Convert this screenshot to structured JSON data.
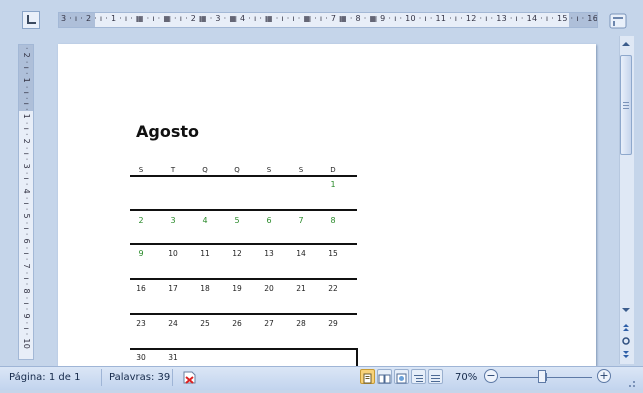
{
  "ruler": {
    "horizontal_text": "3 · ı · 2 · ı · 1 · ı · ▦ · ı · ▦ · ı · 2 ▦ · 3 · ▦ 4 · ı · ▦ · ı · ı · ▦ · ı · 7 ▦ · 8 · ▦ 9 · ı · 10 · ı · 11 · ı · 12 · ı · 13 · ı · 14 · ı · 15 · ı · 16 · ı · 17 · ı ·",
    "vertical_text": "· 2 · ı · 1 · ı · ı · 1 · ı · 2 · ı · 3 · ı · 4 · ı · 5 · ı · 6 · ı · 7 · ı · 8 · ı · 9 · ı · 10"
  },
  "document": {
    "title": "Agosto",
    "day_headers": [
      "S",
      "T",
      "Q",
      "Q",
      "S",
      "S",
      "D"
    ],
    "weeks": [
      [
        "",
        "",
        "",
        "",
        "",
        "",
        "1"
      ],
      [
        "2",
        "3",
        "4",
        "5",
        "6",
        "7",
        "8"
      ],
      [
        "9",
        "10",
        "11",
        "12",
        "13",
        "14",
        "15"
      ],
      [
        "16",
        "17",
        "18",
        "19",
        "20",
        "21",
        "22"
      ],
      [
        "23",
        "24",
        "25",
        "26",
        "27",
        "28",
        "29"
      ],
      [
        "30",
        "31",
        "",
        "",
        "",
        "",
        ""
      ]
    ]
  },
  "status_bar": {
    "page_label": "Página: 1 de 1",
    "words_label": "Palavras: 39",
    "zoom_label": "70%",
    "zoom_minus": "−",
    "zoom_plus": "+"
  },
  "colors": {
    "ui_background": "#c5d5ea",
    "status_bar": "#c2d4ee",
    "spelling_mark": "#2a8a2a"
  },
  "icons": {
    "ruler_corner": "tab-stop-icon",
    "ruler_toggle": "view-ruler-icon",
    "proofing": "proofing-status-icon",
    "views": [
      "print-layout-icon",
      "full-screen-reading-icon",
      "web-layout-icon",
      "outline-icon",
      "draft-icon"
    ],
    "scroll": [
      "scroll-up-icon",
      "scroll-down-icon",
      "previous-page-icon",
      "select-browse-object-icon",
      "next-page-icon"
    ]
  },
  "zoom_level": 70
}
